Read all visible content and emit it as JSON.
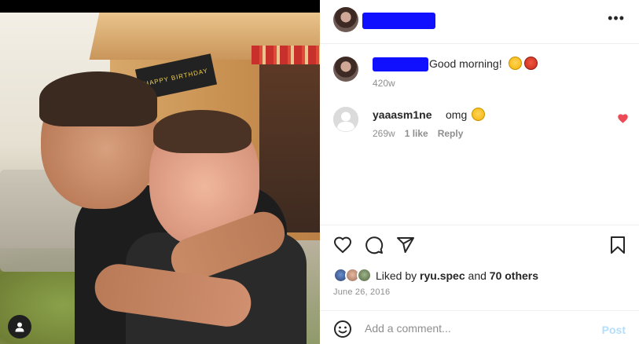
{
  "post": {
    "media": {
      "sign_text": "HAPPY BIRTHDAY"
    }
  },
  "header": {
    "more_label": "•••"
  },
  "caption": {
    "text": "Good morning!",
    "emojis": [
      "smiling-face-with-halo",
      "smiling-face-with-horns"
    ],
    "time": "420w"
  },
  "comments": [
    {
      "username": "yaaasm1ne",
      "text": "omg",
      "emoji": "loudly-crying-face",
      "time": "269w",
      "likes": "1 like",
      "reply_label": "Reply",
      "liked": true
    }
  ],
  "likes": {
    "prefix": "Liked by",
    "user": "ryu.spec",
    "conjunction": "and",
    "others": "70 others"
  },
  "date": "June 26, 2016",
  "add_comment": {
    "placeholder": "Add a comment...",
    "post_label": "Post"
  },
  "colors": {
    "redaction": "#1010ff",
    "heart": "#ed4956",
    "post_disabled": "#b2dffc",
    "secondary_text": "#8e8e8e"
  }
}
